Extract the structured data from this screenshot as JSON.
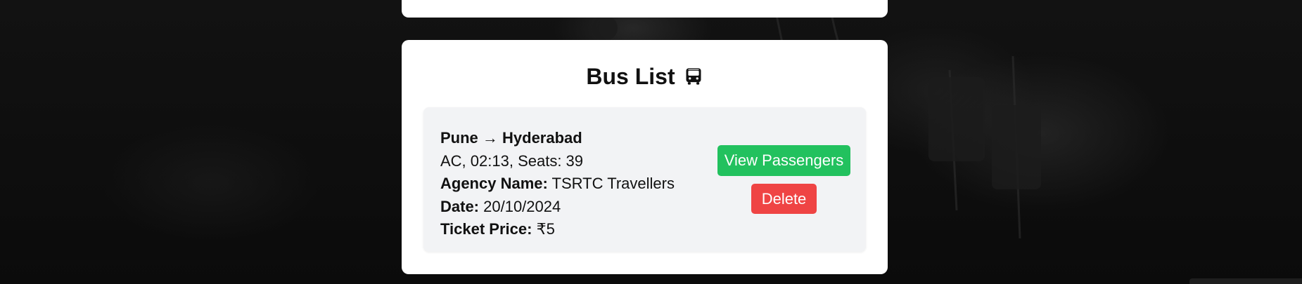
{
  "bus_list": {
    "title": "Bus List",
    "title_icon": "bus-icon",
    "buses": [
      {
        "route": "Pune → Hyderabad",
        "details": "AC, 02:13, Seats: 39",
        "agency_label": "Agency Name:",
        "agency_value": " TSRTC Travellers",
        "date_label": "Date:",
        "date_value": " 20/10/2024",
        "price_label": "Ticket Price:",
        "price_value": " ₹5",
        "view_button": "View Passengers",
        "delete_button": "Delete"
      }
    ]
  },
  "colors": {
    "view_button": "#22c15e",
    "delete_button": "#ef4444",
    "card_bg": "#ffffff",
    "item_bg": "#f2f3f5"
  }
}
